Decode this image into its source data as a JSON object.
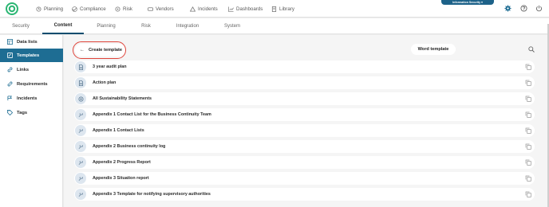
{
  "nav": {
    "items": [
      {
        "label": "Planning",
        "icon": "planning-icon"
      },
      {
        "label": "Compliance",
        "icon": "compliance-icon"
      },
      {
        "label": "Risk",
        "icon": "risk-icon"
      },
      {
        "label": "Vendors",
        "icon": "vendors-icon"
      },
      {
        "label": "Incidents",
        "icon": "incidents-icon"
      },
      {
        "label": "Dashboards",
        "icon": "dashboards-icon"
      },
      {
        "label": "Library",
        "icon": "library-icon"
      }
    ],
    "environment_badge": "Information Security ▾",
    "brand_color": "#1e6d93"
  },
  "tabs": [
    {
      "label": "Security"
    },
    {
      "label": "Content",
      "active": true
    },
    {
      "label": "Planning"
    },
    {
      "label": "Risk"
    },
    {
      "label": "Integration"
    },
    {
      "label": "System"
    }
  ],
  "sidebar": {
    "items": [
      {
        "label": "Data lists",
        "icon": "data-list-icon"
      },
      {
        "label": "Templates",
        "icon": "template-icon",
        "active": true
      },
      {
        "label": "Links",
        "icon": "link-icon"
      },
      {
        "label": "Requirements",
        "icon": "requirements-icon"
      },
      {
        "label": "Incidents",
        "icon": "incidents-icon"
      },
      {
        "label": "Tags",
        "icon": "tag-icon"
      }
    ]
  },
  "toolbar": {
    "create_label": "Create template",
    "word_label": "Word template"
  },
  "templates": [
    {
      "label": "3 year audit plan",
      "icon": "document-icon"
    },
    {
      "label": "Action plan",
      "icon": "document-icon"
    },
    {
      "label": "All Sustainability Statements",
      "icon": "sustainability-icon"
    },
    {
      "label": "Appendix 1 Contact List for the Business Continuity Team",
      "icon": "continuity-icon"
    },
    {
      "label": "Appendix 1 Contact Lists",
      "icon": "continuity-icon"
    },
    {
      "label": "Appendix 2 Business continuity log",
      "icon": "continuity-icon"
    },
    {
      "label": "Appendix 2 Progress Report",
      "icon": "continuity-icon"
    },
    {
      "label": "Appendix 3 Situation report",
      "icon": "continuity-icon"
    },
    {
      "label": "Appendix 3 Template for notifying supervisory authorities",
      "icon": "continuity-icon"
    }
  ]
}
